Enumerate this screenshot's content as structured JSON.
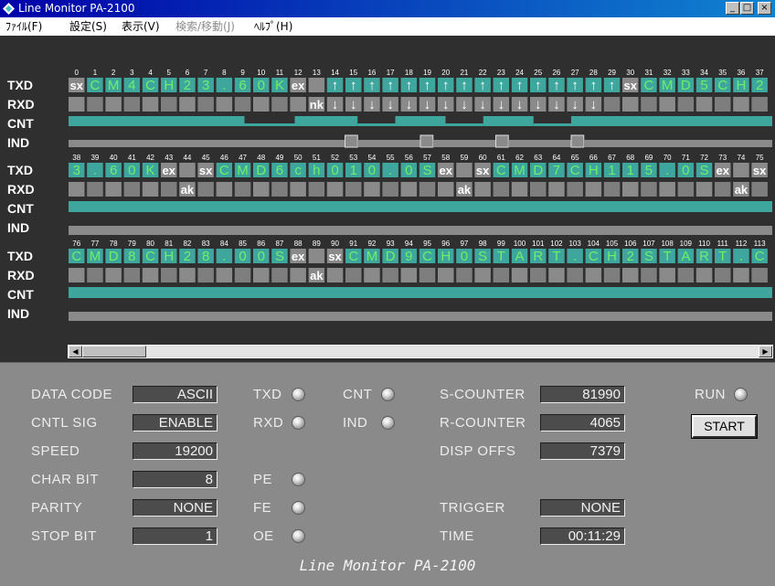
{
  "window": {
    "title": "Line Monitor PA-2100",
    "minimize_glyph": "_",
    "maximize_glyph": "□",
    "close_glyph": "×"
  },
  "menu": [
    {
      "label": "ﾌｧｲﾙ(F)",
      "enabled": true
    },
    {
      "label": "設定(S)",
      "enabled": true
    },
    {
      "label": "表示(V)",
      "enabled": true
    },
    {
      "label": "検索/移動(J)",
      "enabled": false
    },
    {
      "label": "ﾍﾙﾌﾟ(H)",
      "enabled": true
    }
  ],
  "monitor": {
    "row_labels": [
      "TXD",
      "RXD",
      "CNT",
      "IND"
    ],
    "colors": {
      "background": "#2f2f2f",
      "block": "#3fa69e",
      "block_gray": "#8a8a8a",
      "data_text": "#6cf06a",
      "control_text": "#ffffff",
      "index_text": "#ffffff",
      "label_text": "#ffffff",
      "signal_high": "#3fa69e",
      "signal_low": "#8a8a8a"
    },
    "sections": [
      {
        "txd": [
          "sx",
          "C",
          "M",
          "4",
          "C",
          "H",
          "2",
          "3",
          ".",
          "6",
          "0",
          "K",
          "ex",
          "",
          "↑",
          "↑",
          "↑",
          "↑",
          "↑",
          "↑",
          "↑",
          "↑",
          "↑",
          "↑",
          "↑",
          "↑",
          "↑",
          "↑",
          "↑",
          "↑",
          "sx",
          "C",
          "M",
          "D",
          "5",
          "C",
          "H",
          "2"
        ],
        "rxd": [
          "",
          "",
          "",
          "",
          "",
          "",
          "",
          "",
          "",
          "",
          "",
          "",
          "",
          "nk",
          "↓",
          "↓",
          "↓",
          "↓",
          "↓",
          "↓",
          "↓",
          "↓",
          "↓",
          "↓",
          "↓",
          "↓",
          "↓",
          "↓",
          "↓",
          "",
          "",
          "",
          "",
          "",
          "",
          "",
          "",
          ""
        ],
        "cnt": "11111111111111000011111000111100011110001111111111111111",
        "ind": "00000000000000000000001000001000001000001000000000000000"
      },
      {
        "txd": [
          "3",
          ".",
          "6",
          "0",
          "K",
          "ex",
          "",
          "sx",
          "C",
          "M",
          "D",
          "6",
          "c",
          "h",
          "0",
          "1",
          "0",
          ".",
          "0",
          "S",
          "ex",
          "",
          "sx",
          "C",
          "M",
          "D",
          "7",
          "C",
          "H",
          "1",
          "1",
          "5",
          ".",
          "0",
          "S",
          "ex",
          "",
          "sx"
        ],
        "rxd": [
          "",
          "",
          "",
          "",
          "",
          "",
          "ak",
          "",
          "",
          "",
          "",
          "",
          "",
          "",
          "",
          "",
          "",
          "",
          "",
          "",
          "",
          "ak",
          "",
          "",
          "",
          "",
          "",
          "",
          "",
          "",
          "",
          "",
          "",
          "",
          "",
          "",
          "ak",
          ""
        ],
        "cnt": "1",
        "ind": "0"
      },
      {
        "txd": [
          "C",
          "M",
          "D",
          "8",
          "C",
          "H",
          "2",
          "8",
          ".",
          "0",
          "0",
          "S",
          "ex",
          "",
          "sx",
          "C",
          "M",
          "D",
          "9",
          "C",
          "H",
          "0",
          "S",
          "T",
          "A",
          "R",
          "T",
          ".",
          "C",
          "H",
          "2",
          "S",
          "T",
          "A",
          "R",
          "T",
          ".",
          "C"
        ],
        "rxd": [
          "",
          "",
          "",
          "",
          "",
          "",
          "",
          "",
          "",
          "",
          "",
          "",
          "",
          "ak",
          "",
          "",
          "",
          "",
          "",
          "",
          "",
          "",
          "",
          "",
          "",
          "",
          "",
          "",
          "",
          "",
          "",
          "",
          "",
          "",
          "",
          "",
          "",
          ""
        ],
        "cnt": "1",
        "ind": "0"
      }
    ]
  },
  "panel": {
    "fields": [
      {
        "key": "data_code",
        "label": "DATA CODE",
        "value": "ASCII"
      },
      {
        "key": "cntl_sig",
        "label": "CNTL SIG",
        "value": "ENABLE"
      },
      {
        "key": "speed",
        "label": "SPEED",
        "value": "19200"
      },
      {
        "key": "char_bit",
        "label": "CHAR BIT",
        "value": "8"
      },
      {
        "key": "parity",
        "label": "PARITY",
        "value": "NONE"
      },
      {
        "key": "stop_bit",
        "label": "STOP BIT",
        "value": "1"
      }
    ],
    "counters": [
      {
        "key": "s_counter",
        "label": "S-COUNTER",
        "value": "81990"
      },
      {
        "key": "r_counter",
        "label": "R-COUNTER",
        "value": "4065"
      },
      {
        "key": "disp_offs",
        "label": "DISP OFFS",
        "value": "7379"
      },
      {
        "key": "trigger",
        "label": "TRIGGER",
        "value": "NONE"
      },
      {
        "key": "time",
        "label": "TIME",
        "value": "00:11:29"
      }
    ],
    "indicators": {
      "txd": "TXD",
      "rxd": "RXD",
      "cnt": "CNT",
      "ind": "IND",
      "pe": "PE",
      "fe": "FE",
      "oe": "OE",
      "run": "RUN"
    },
    "start_button": "START",
    "footer": "Line Monitor PA-2100"
  }
}
